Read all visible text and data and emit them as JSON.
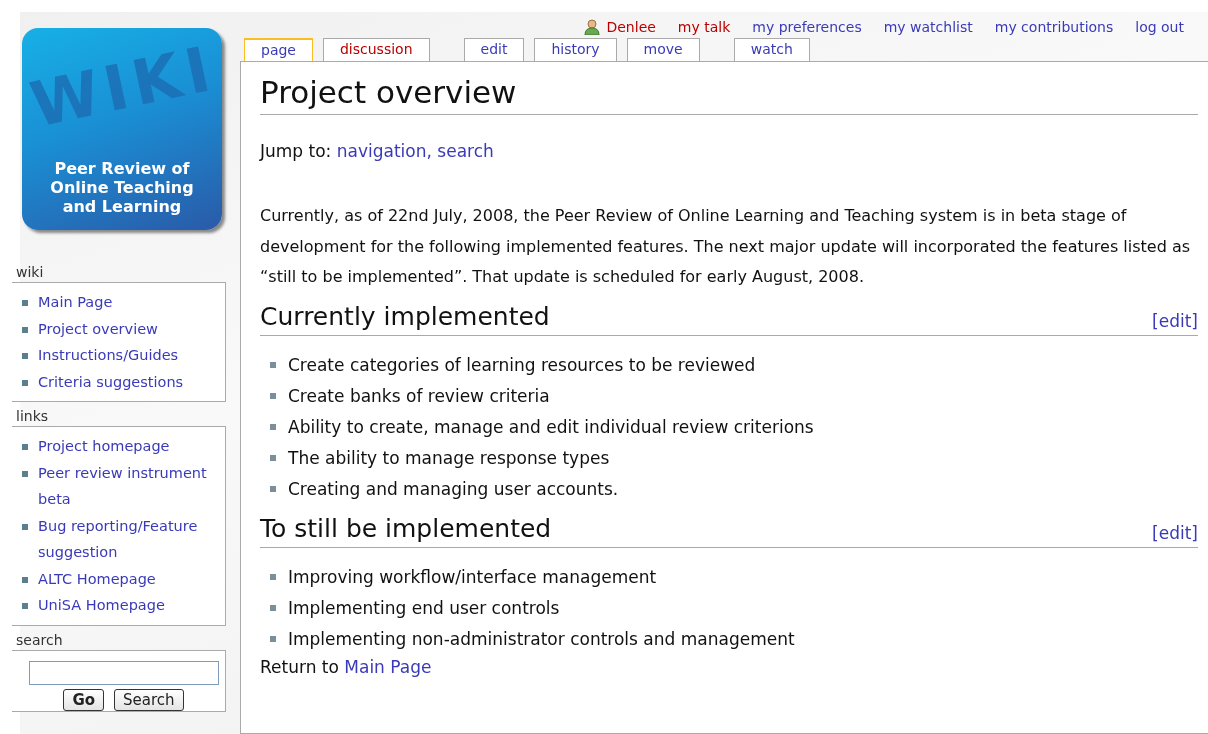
{
  "logo": {
    "wordmark": "WIKI",
    "caption": "Peer Review of Online Teaching and Learning"
  },
  "personal_links": [
    {
      "label": "Denlee",
      "new": true,
      "kind": "user"
    },
    {
      "label": "my talk",
      "new": true,
      "kind": "link"
    },
    {
      "label": "my preferences",
      "new": false,
      "kind": "link"
    },
    {
      "label": "my watchlist",
      "new": false,
      "kind": "link"
    },
    {
      "label": "my contributions",
      "new": false,
      "kind": "link"
    },
    {
      "label": "log out",
      "new": false,
      "kind": "link"
    }
  ],
  "tab_groups": [
    [
      {
        "label": "page",
        "selected": true,
        "new": false
      },
      {
        "label": "discussion",
        "selected": false,
        "new": true
      }
    ],
    [
      {
        "label": "edit",
        "selected": false,
        "new": false
      },
      {
        "label": "history",
        "selected": false,
        "new": false
      },
      {
        "label": "move",
        "selected": false,
        "new": false
      }
    ],
    [
      {
        "label": "watch",
        "selected": false,
        "new": false
      }
    ]
  ],
  "sidebar": [
    {
      "title": "wiki",
      "kind": "links",
      "items": [
        "Main Page",
        "Project overview",
        "Instructions/Guides",
        "Criteria suggestions"
      ]
    },
    {
      "title": "links",
      "kind": "links",
      "items": [
        "Project homepage",
        "Peer review instrument beta",
        "Bug reporting/Feature suggestion",
        "ALTC Homepage",
        "UniSA Homepage"
      ]
    },
    {
      "title": "search",
      "kind": "search",
      "buttons": [
        "Go",
        "Search"
      ]
    }
  ],
  "content": {
    "title": "Project overview",
    "jump_label": "Jump to:",
    "jump_links": [
      "navigation",
      "search"
    ],
    "jump_separator": ",",
    "intro": "Currently, as of 22nd July, 2008, the Peer Review of Online Learning and Teaching system is in beta stage of development for the following implemented features. The next major update will incorporated the features listed as “still to be implemented”. That update is scheduled for early August, 2008.",
    "sections": [
      {
        "heading": "Currently implemented",
        "edit": "[edit]",
        "items": [
          "Create categories of learning resources to be reviewed",
          "Create banks of review criteria",
          "Ability to create, manage and edit individual review criterions",
          "The ability to manage response types",
          "Creating and managing user accounts."
        ]
      },
      {
        "heading": "To still be implemented",
        "edit": "[edit]",
        "items": [
          "Improving workflow/interface management",
          "Implementing end user controls",
          "Implementing non-administrator controls and management"
        ]
      }
    ],
    "return_label": "Return to",
    "return_link": "Main Page"
  }
}
